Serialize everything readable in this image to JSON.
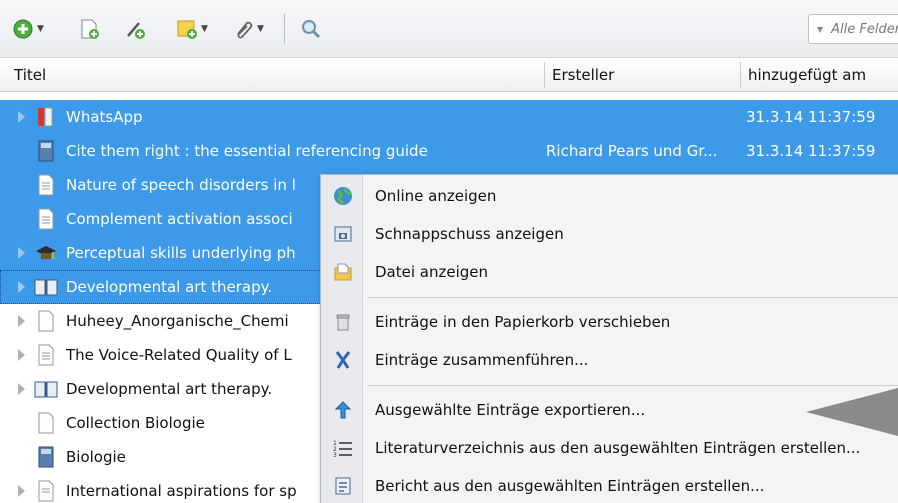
{
  "toolbar": {
    "buttons": [
      {
        "name": "new-item-button",
        "icon": "green-plus-icon",
        "dropdown": true
      },
      {
        "name": "new-note-button",
        "icon": "document-plus-icon",
        "dropdown": false
      },
      {
        "name": "add-by-identifier-button",
        "icon": "magic-wand-icon",
        "dropdown": false
      },
      {
        "name": "new-standalone-note-button",
        "icon": "note-plus-icon",
        "dropdown": true
      },
      {
        "name": "add-attachment-button",
        "icon": "paperclip-icon",
        "dropdown": true
      },
      {
        "name": "advanced-search-button",
        "icon": "magnifier-icon",
        "dropdown": false
      }
    ],
    "search_placeholder": "Alle Felder"
  },
  "columns": {
    "title": "Titel",
    "creator": "Ersteller",
    "added": "hinzugefügt am"
  },
  "rows": [
    {
      "title": "WhatsApp",
      "creator": "",
      "added": "31.3.14 11:37:59",
      "icon": "book-red-icon",
      "twisty": true,
      "selected": true
    },
    {
      "title": "Cite them right : the essential referencing guide",
      "creator": "Richard Pears und Gr...",
      "added": "31.3.14 11:37:59",
      "icon": "book-blue-icon",
      "twisty": false,
      "selected": true
    },
    {
      "title": "Nature of speech disorders in l",
      "creator": "",
      "added": "",
      "icon": "document-icon",
      "twisty": false,
      "selected": true
    },
    {
      "title": "Complement activation associ",
      "creator": "",
      "added": "",
      "icon": "document-icon",
      "twisty": false,
      "selected": true
    },
    {
      "title": "Perceptual skills underlying ph",
      "creator": "",
      "added": "",
      "icon": "graduation-cap-icon",
      "twisty": true,
      "selected": true
    },
    {
      "title": "Developmental art therapy.",
      "creator": "",
      "added": "",
      "icon": "open-book-icon",
      "twisty": true,
      "selected": true
    },
    {
      "title": "Huheey_Anorganische_Chemi",
      "creator": "",
      "added": "",
      "icon": "blank-page-icon",
      "twisty": true,
      "selected": false
    },
    {
      "title": "The Voice-Related Quality of L",
      "creator": "",
      "added": "",
      "icon": "document-icon",
      "twisty": true,
      "selected": false
    },
    {
      "title": "Developmental art therapy.",
      "creator": "",
      "added": "",
      "icon": "open-book-icon",
      "twisty": true,
      "selected": false
    },
    {
      "title": "Collection Biologie",
      "creator": "",
      "added": "",
      "icon": "blank-page-icon",
      "twisty": false,
      "selected": false
    },
    {
      "title": "Biologie",
      "creator": "",
      "added": "",
      "icon": "book-blue-icon",
      "twisty": false,
      "selected": false
    },
    {
      "title": "International aspirations for sp",
      "creator": "",
      "added": "",
      "icon": "document-icon",
      "twisty": true,
      "selected": false
    }
  ],
  "context_menu": {
    "items": [
      {
        "label": "Online anzeigen",
        "icon": "globe-icon"
      },
      {
        "label": "Schnappschuss anzeigen",
        "icon": "snapshot-icon"
      },
      {
        "label": "Datei anzeigen",
        "icon": "folder-file-icon"
      },
      {
        "label": "Einträge in den Papierkorb verschieben",
        "icon": "trash-icon"
      },
      {
        "label": "Einträge zusammenführen...",
        "icon": "merge-icon"
      },
      {
        "label": "Ausgewählte Einträge exportieren...",
        "icon": "export-arrow-icon"
      },
      {
        "label": "Literaturverzeichnis aus den ausgewählten Einträgen erstellen...",
        "icon": "list-icon"
      },
      {
        "label": "Bericht aus den ausgewählten Einträgen erstellen...",
        "icon": "report-icon"
      }
    ]
  },
  "colors": {
    "selection": "#3d9ae8",
    "overlay_arrow": "#8a8a8a"
  }
}
